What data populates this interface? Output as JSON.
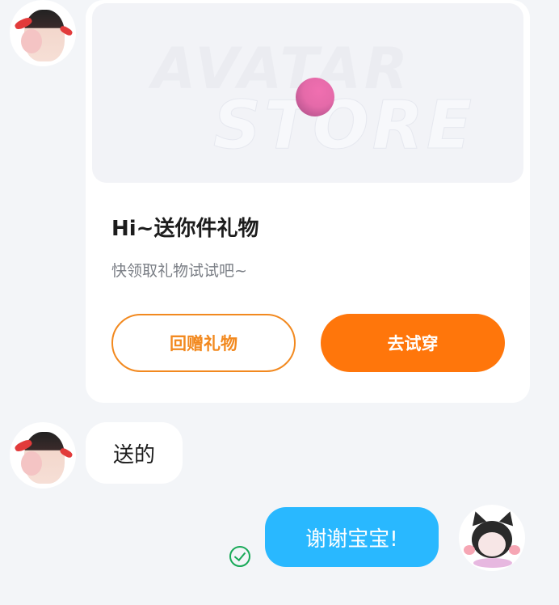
{
  "card": {
    "banner_text_line1": "AVATAR",
    "banner_text_line2": "STORE",
    "title": "Hi~送你件礼物",
    "subtitle": "快领取礼物试试吧~",
    "return_gift_label": "回赠礼物",
    "try_on_label": "去试穿"
  },
  "messages": [
    {
      "from": "other",
      "text": "送的"
    },
    {
      "from": "self",
      "text": "谢谢宝宝!",
      "status": "sent-check-icon"
    }
  ],
  "colors": {
    "accent_orange": "#ff760b",
    "outline_orange": "#f2891f",
    "self_bubble": "#29b8ff",
    "sent_check": "#18a958"
  }
}
